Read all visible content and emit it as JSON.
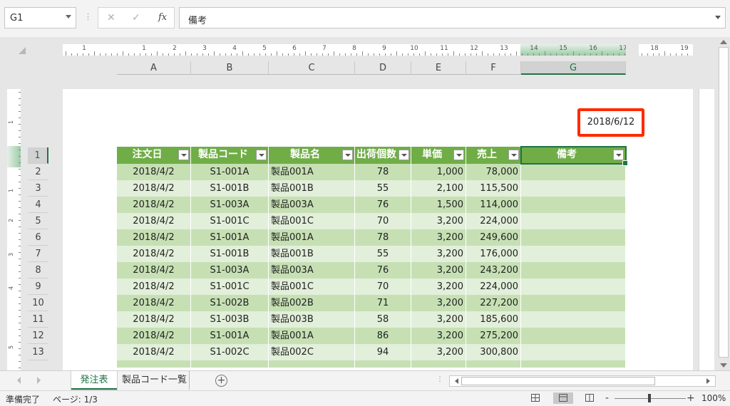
{
  "formula_bar": {
    "name_box": "G1",
    "cancel_icon": "✕",
    "enter_icon": "✓",
    "fx_label": "fx",
    "formula_value": "備考"
  },
  "ruler_h": [
    "1",
    "1",
    "2",
    "3",
    "4",
    "5",
    "6",
    "7",
    "8",
    "9",
    "10",
    "11",
    "12",
    "13",
    "14",
    "15",
    "16",
    "17",
    "18",
    "19"
  ],
  "ruler_v": [
    "1",
    "1",
    "2",
    "3",
    "4",
    "5",
    "6"
  ],
  "columns": [
    {
      "label": "A",
      "active": false
    },
    {
      "label": "B",
      "active": false
    },
    {
      "label": "C",
      "active": false
    },
    {
      "label": "D",
      "active": false
    },
    {
      "label": "E",
      "active": false
    },
    {
      "label": "F",
      "active": false
    },
    {
      "label": "G",
      "active": true
    }
  ],
  "rows": [
    "1",
    "2",
    "3",
    "4",
    "5",
    "6",
    "7",
    "8",
    "9",
    "10",
    "11",
    "12",
    "13"
  ],
  "header_date": "2018/6/12",
  "table": {
    "headers": [
      "注文日",
      "製品コード",
      "製品名",
      "出荷個数",
      "単価",
      "売上",
      "備考"
    ],
    "rows": [
      [
        "2018/4/2",
        "S1-001A",
        "製品001A",
        "78",
        "1,000",
        "78,000",
        ""
      ],
      [
        "2018/4/2",
        "S1-001B",
        "製品001B",
        "55",
        "2,100",
        "115,500",
        ""
      ],
      [
        "2018/4/2",
        "S1-003A",
        "製品003A",
        "76",
        "1,500",
        "114,000",
        ""
      ],
      [
        "2018/4/2",
        "S1-001C",
        "製品001C",
        "70",
        "3,200",
        "224,000",
        ""
      ],
      [
        "2018/4/2",
        "S1-001A",
        "製品001A",
        "78",
        "3,200",
        "249,600",
        ""
      ],
      [
        "2018/4/2",
        "S1-001B",
        "製品001B",
        "55",
        "3,200",
        "176,000",
        ""
      ],
      [
        "2018/4/2",
        "S1-003A",
        "製品003A",
        "76",
        "3,200",
        "243,200",
        ""
      ],
      [
        "2018/4/2",
        "S1-001C",
        "製品001C",
        "70",
        "3,200",
        "224,000",
        ""
      ],
      [
        "2018/4/2",
        "S1-002B",
        "製品002B",
        "71",
        "3,200",
        "227,200",
        ""
      ],
      [
        "2018/4/2",
        "S1-003B",
        "製品003B",
        "58",
        "3,200",
        "185,600",
        ""
      ],
      [
        "2018/4/2",
        "S1-001A",
        "製品001A",
        "86",
        "3,200",
        "275,200",
        ""
      ],
      [
        "2018/4/2",
        "S1-002C",
        "製品002C",
        "94",
        "3,200",
        "300,800",
        ""
      ]
    ]
  },
  "sheet_tabs": [
    "発注表",
    "製品コード一覧"
  ],
  "add_sheet_label": "+",
  "status": {
    "ready": "準備完了",
    "page": "ページ: 1/3",
    "zoom_minus": "-",
    "zoom_plus": "+",
    "zoom": "100%"
  },
  "colors": {
    "header_green": "#70ad47",
    "row_dark": "#c6e0b4",
    "row_light": "#e2efda",
    "excel_green": "#217346",
    "highlight_red": "#ff2a00"
  }
}
